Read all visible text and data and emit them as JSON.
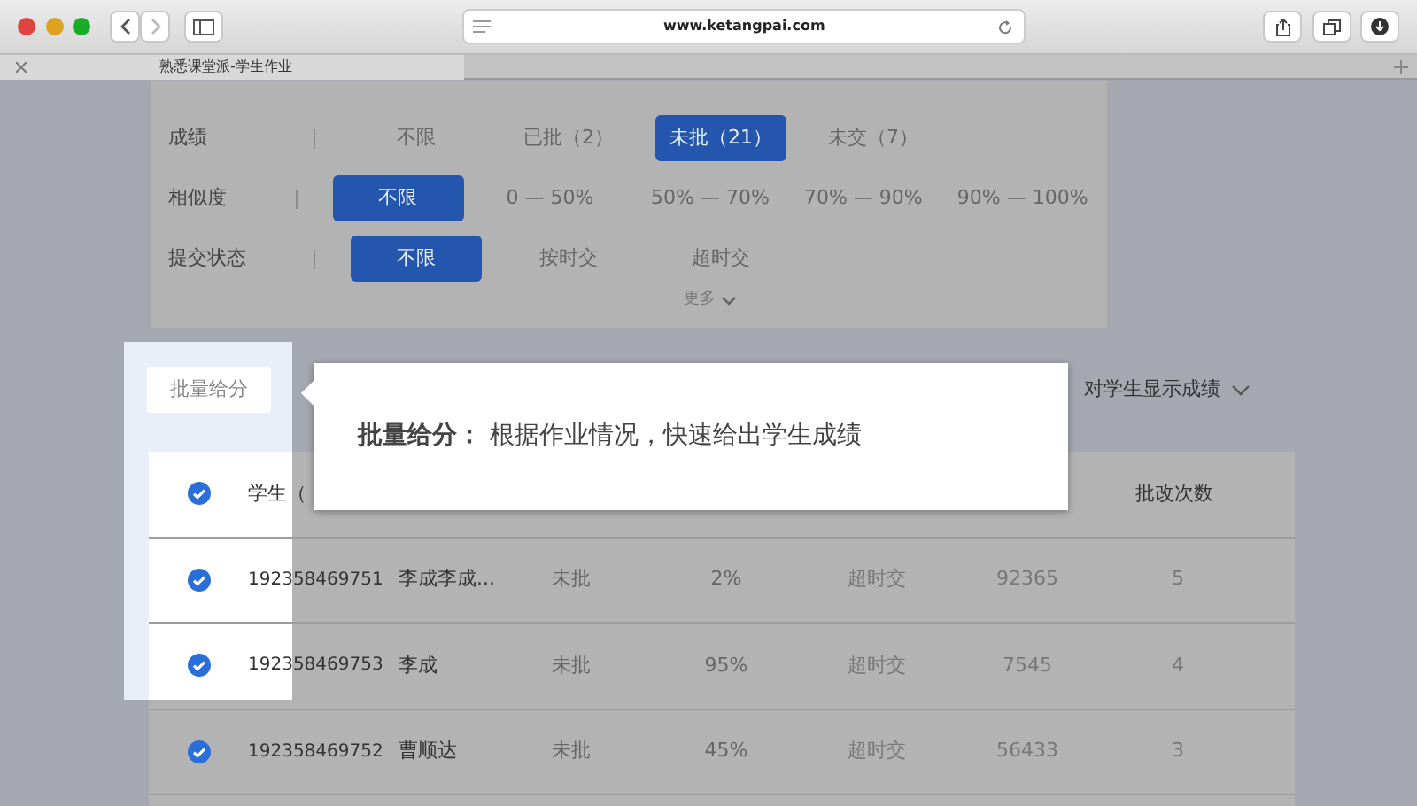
{
  "browser": {
    "url": "www.ketangpai.com",
    "tab_title": "熟悉课堂派-学生作业"
  },
  "filters": [
    {
      "label": "成绩",
      "options": [
        {
          "label": "不限",
          "selected": false
        },
        {
          "label": "已批（2）",
          "selected": false
        },
        {
          "label": "未批（21）",
          "selected": true
        },
        {
          "label": "未交（7）",
          "selected": false
        }
      ]
    },
    {
      "label": "相似度",
      "options": [
        {
          "label": "不限",
          "selected": true
        },
        {
          "label": "0 — 50%",
          "selected": false
        },
        {
          "label": "50% — 70%",
          "selected": false
        },
        {
          "label": "70% — 90%",
          "selected": false
        },
        {
          "label": "90% — 100%",
          "selected": false
        }
      ]
    },
    {
      "label": "提交状态",
      "options": [
        {
          "label": "不限",
          "selected": true
        },
        {
          "label": "按时交",
          "selected": false
        },
        {
          "label": "超时交",
          "selected": false
        }
      ]
    }
  ],
  "more": "更多",
  "batch_button": "批量给分",
  "tooltip": {
    "title": "批量给分：",
    "text": "根据作业情况，快速给出学生成绩"
  },
  "display_toggle": "对学生显示成绩",
  "table": {
    "header_checked": true,
    "student_header": "学生（",
    "count_header": "批改次数",
    "rows": [
      {
        "checked": true,
        "id": "192358469751",
        "name": "李成李成...",
        "status": "未批",
        "similarity": "2%",
        "submit_state": "超时交",
        "column_7": "92365",
        "count": "5"
      },
      {
        "checked": true,
        "id": "192358469753",
        "name": "李成",
        "status": "未批",
        "similarity": "95%",
        "submit_state": "超时交",
        "column_7": "7545",
        "count": "4"
      },
      {
        "checked": true,
        "id": "192358469752",
        "name": "曹顺达",
        "status": "未批",
        "similarity": "45%",
        "submit_state": "超时交",
        "column_7": "56433",
        "count": "3"
      }
    ]
  }
}
